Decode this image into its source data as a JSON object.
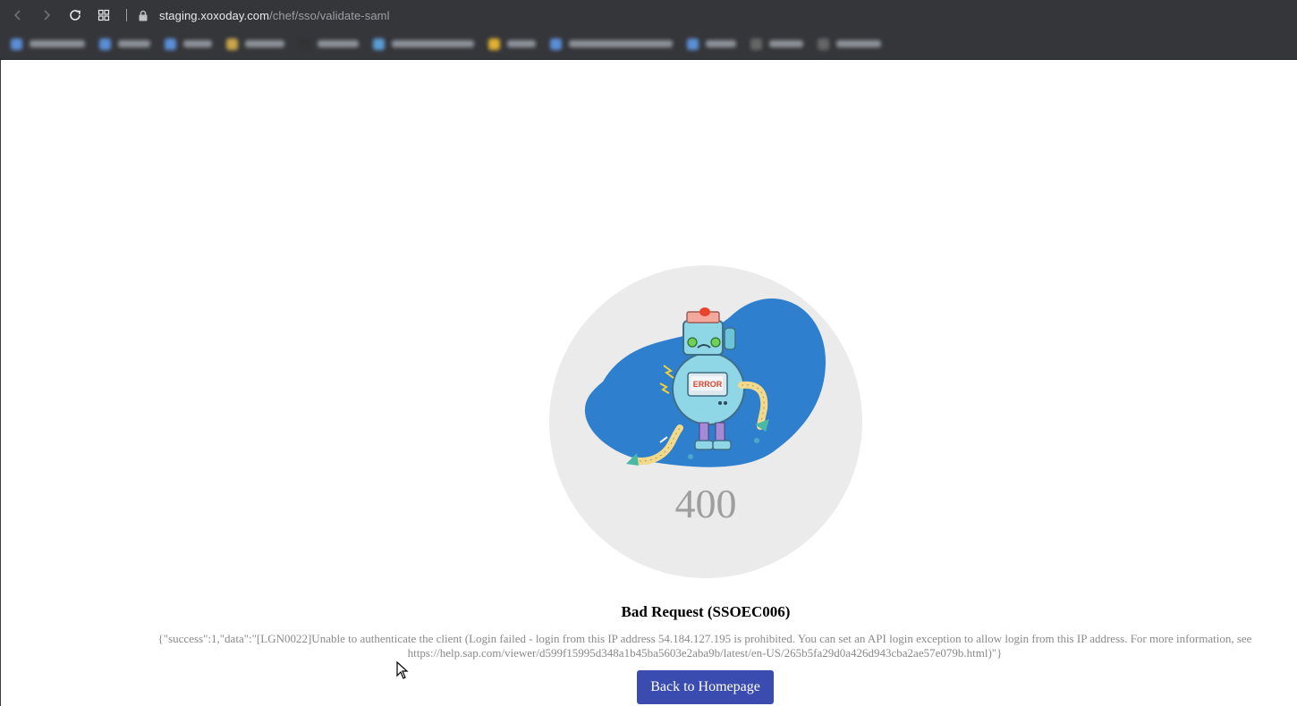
{
  "browser": {
    "url_host": "staging.xoxoday.com",
    "url_path": "/chef/sso/validate-saml",
    "icons": [
      "back-icon",
      "forward-icon",
      "reload-icon",
      "apps-icon",
      "lock-icon"
    ]
  },
  "error": {
    "code": "400",
    "title": "Bad Request (SSOEC006)",
    "message": "{\"success\":1,\"data\":\"[LGN0022]Unable to authenticate the client (Login failed - login from this IP address 54.184.127.195 is prohibited. You can set an API login exception to allow login from this IP address. For more information, see https://help.sap.com/viewer/d599f15995d348a1b45ba5603e2aba9b/latest/en-US/265b5fa29d0a426d943cba2ae57e079b.html)\"}",
    "button_label": "Back to Homepage"
  },
  "colors": {
    "browser_bar": "#35363a",
    "button": "#3a4cb0",
    "blob": "#2f7fcf",
    "circle": "#ebebeb"
  }
}
